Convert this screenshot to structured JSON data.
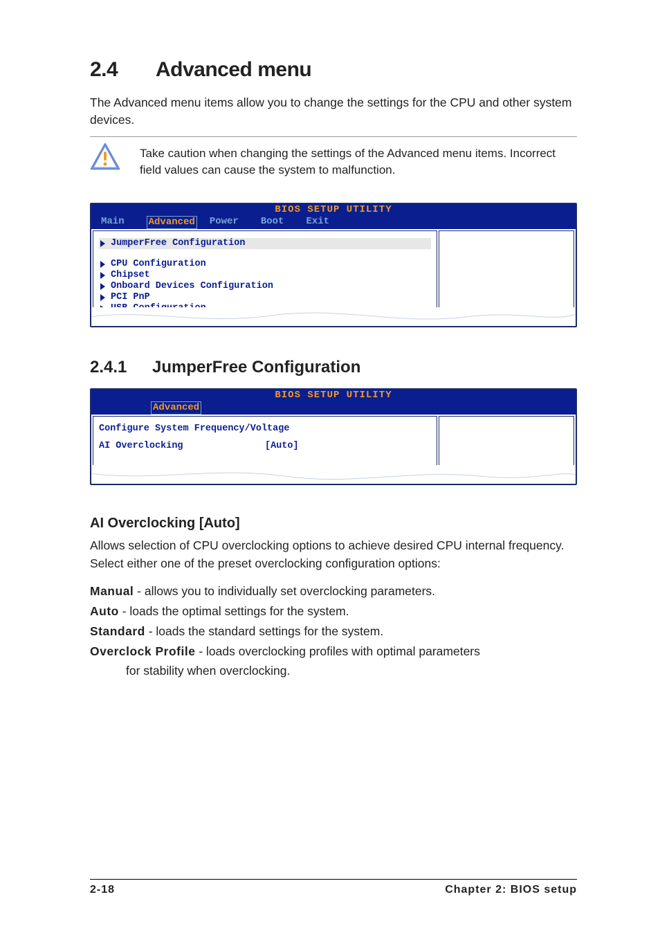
{
  "section": {
    "number": "2.4",
    "title": "Advanced menu"
  },
  "intro": "The Advanced menu items allow you to change the settings for the CPU and other system devices.",
  "caution": "Take caution when changing the settings of the Advanced menu items. Incorrect field values can cause the system to malfunction.",
  "bios1": {
    "title": "BIOS SETUP UTILITY",
    "tabs": [
      "Main",
      "Advanced",
      "Power",
      "Boot",
      "Exit"
    ],
    "selected_tab": "Advanced",
    "items_group1": [
      "JumperFree Configuration"
    ],
    "items_group2": [
      "CPU Configuration",
      "Chipset",
      "Onboard Devices Configuration",
      "PCI PnP",
      "USB Configuration"
    ]
  },
  "subsection": {
    "number": "2.4.1",
    "title": "JumperFree Configuration"
  },
  "bios2": {
    "title": "BIOS SETUP UTILITY",
    "selected_tab": "Advanced",
    "headline": "Configure System Frequency/Voltage",
    "setting_label": "AI Overclocking",
    "setting_value": "[Auto]"
  },
  "option_heading": "AI Overclocking [Auto]",
  "option_desc": "Allows selection of CPU overclocking options to achieve desired CPU internal frequency. Select either one of the preset overclocking configuration options:",
  "options": [
    {
      "name": "Manual",
      "desc": " - allows you to individually set overclocking parameters."
    },
    {
      "name": "Auto",
      "desc": " - loads the optimal settings for the system."
    },
    {
      "name": "Standard",
      "desc": " - loads the standard settings for the system."
    },
    {
      "name": "Overclock Profile",
      "desc": " - loads overclocking profiles with optimal parameters",
      "cont": "for stability when overclocking."
    }
  ],
  "footer": {
    "page": "2-18",
    "chapter": "Chapter 2: BIOS setup"
  }
}
